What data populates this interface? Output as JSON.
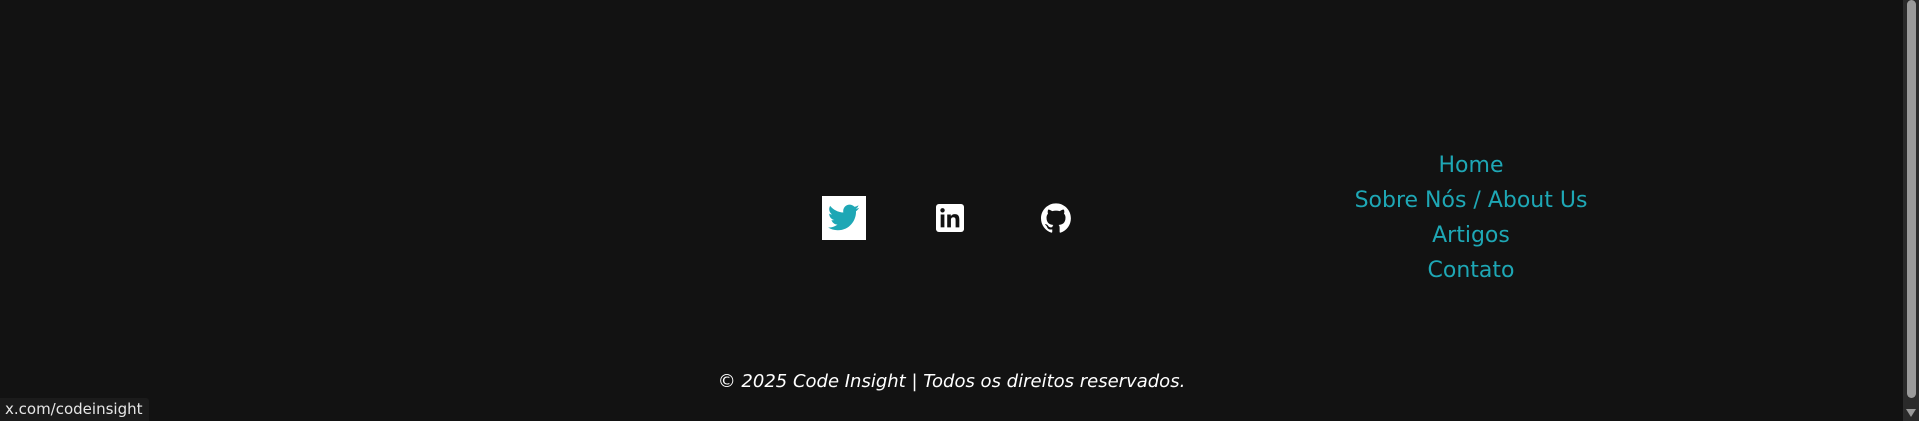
{
  "social": {
    "links": [
      {
        "name": "twitter",
        "icon": "twitter-icon",
        "color": "#1ea7b5",
        "background": "#ffffff"
      },
      {
        "name": "linkedin",
        "icon": "linkedin-icon",
        "color": "#ffffff"
      },
      {
        "name": "github",
        "icon": "github-icon",
        "color": "#ffffff"
      }
    ]
  },
  "nav": {
    "home": "Home",
    "about": "Sobre Nós / About Us",
    "articles": "Artigos",
    "contact": "Contato"
  },
  "footer": {
    "copyright": "© 2025 Code Insight | Todos os direitos reservados."
  },
  "status_bar": {
    "url": "x.com/codeinsight"
  },
  "colors": {
    "background": "#121212",
    "accent": "#1ea7b5",
    "text": "#ffffff"
  }
}
